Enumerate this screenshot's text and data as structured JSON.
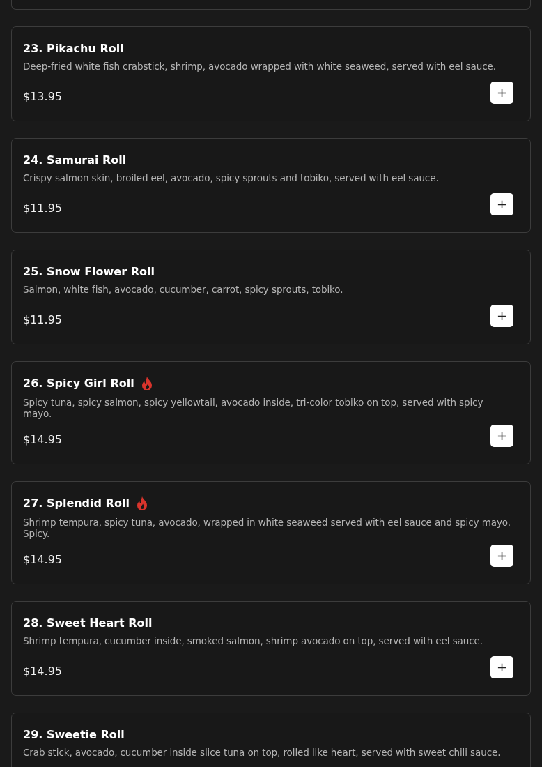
{
  "items": [
    {
      "name": "23. Pikachu Roll",
      "spicy": false,
      "description": "Deep-fried white fish crabstick, shrimp, avocado wrapped with white seaweed, served with eel sauce.",
      "price": "$13.95",
      "add_button": "+"
    },
    {
      "name": "24. Samurai Roll",
      "spicy": false,
      "description": "Crispy salmon skin, broiled eel, avocado, spicy sprouts and tobiko, served with eel sauce.",
      "price": "$11.95",
      "add_button": "+"
    },
    {
      "name": "25. Snow Flower Roll",
      "spicy": false,
      "description": "Salmon, white fish, avocado, cucumber, carrot, spicy sprouts, tobiko.",
      "price": "$11.95",
      "add_button": "+"
    },
    {
      "name": "26. Spicy Girl Roll",
      "spicy": true,
      "description": "Spicy tuna, spicy salmon, spicy yellowtail, avocado inside, tri-color tobiko on top, served with spicy mayo.",
      "price": "$14.95",
      "add_button": "+"
    },
    {
      "name": "27. Splendid Roll",
      "spicy": true,
      "description": "Shrimp tempura, spicy tuna, avocado, wrapped in white seaweed served with eel sauce and spicy mayo. Spicy.",
      "price": "$14.95",
      "add_button": "+"
    },
    {
      "name": "28. Sweet Heart Roll",
      "spicy": false,
      "description": "Shrimp tempura, cucumber inside, smoked salmon, shrimp avocado on top, served with eel sauce.",
      "price": "$14.95",
      "add_button": "+"
    },
    {
      "name": "29. Sweetie Roll",
      "spicy": false,
      "description": "Crab stick, avocado, cucumber inside slice tuna on top, rolled like heart, served with sweet chili sauce."
    }
  ]
}
